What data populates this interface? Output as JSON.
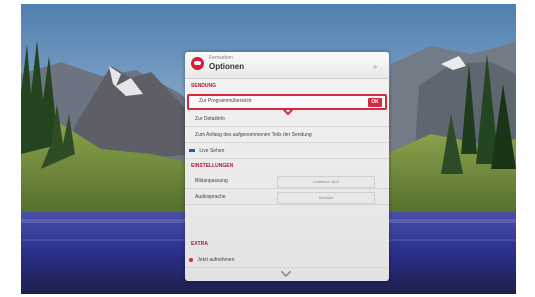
{
  "menu": {
    "header": {
      "subtitle": "Fernsehen",
      "title": "Optionen",
      "collapse_arrow": "»"
    },
    "sections": [
      {
        "label": "SENDUNG",
        "items": [
          {
            "label": "Zur Programmübersicht",
            "selected": true,
            "badge": "OK"
          },
          {
            "label": "Zur Detailinfo"
          },
          {
            "label": "Zum Anfang des aufgenommenen Teils der Sendung"
          },
          {
            "label": "Live Sehen",
            "icon": "blue-dash-icon"
          }
        ]
      },
      {
        "label": "EINSTELLUNGEN",
        "items": [
          {
            "label": "Bildanpassung",
            "value": "Letterbox 16:9"
          },
          {
            "label": "Audiosprache",
            "value": "Deutsch"
          }
        ]
      },
      {
        "label": "EXTRA",
        "items": [
          {
            "label": "Jetzt aufnehmen",
            "icon": "red-dot-icon"
          }
        ]
      }
    ]
  },
  "colors": {
    "accent": "#d42a3e",
    "section_text": "#b01634",
    "live_icon": "#1a5fb4"
  }
}
